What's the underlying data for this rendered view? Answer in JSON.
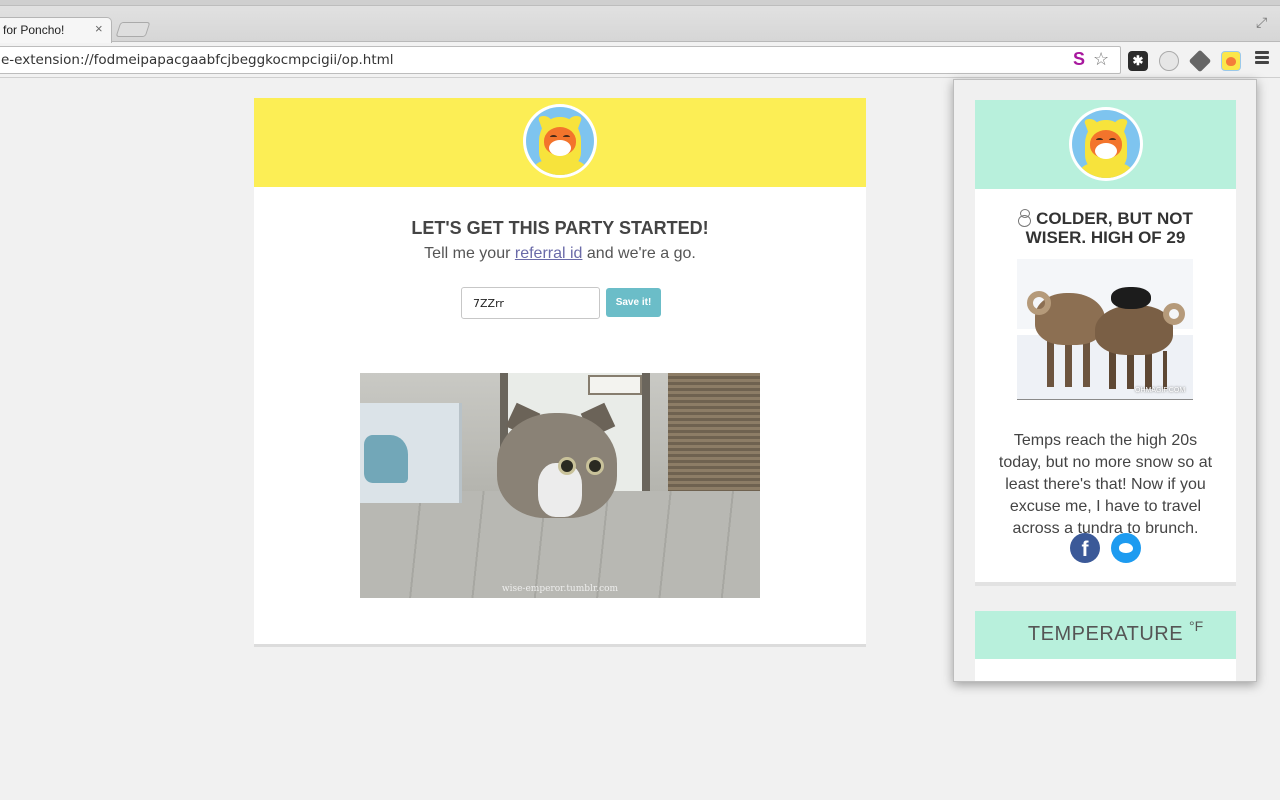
{
  "browser": {
    "tab_title": "for Poncho!",
    "tab_close": "×",
    "url": "e-extension://fodmeipapacgaabfcjbeggkocmpcigii/op.html",
    "omnibox_s": "S",
    "star": "☆",
    "fullscreen": "⤢",
    "extensions": [
      "puzzle-extension",
      "ghost-extension",
      "tag-extension",
      "poncho-extension"
    ]
  },
  "options_page": {
    "heading": "LET'S GET THIS PARTY STARTED!",
    "subtext_before": "Tell me your ",
    "subtext_link": "referral id",
    "subtext_after": " and we're a go.",
    "referral_value": "7ZZrr",
    "save_label": "Save it!",
    "gif_watermark": "wise-emperor.tumblr.com"
  },
  "popup": {
    "weather_title": "COLDER, BUT NOT WISER. HIGH OF 29",
    "gif_watermark": "OHMAGIF.COM",
    "weather_text": "Temps reach the high 20s today, but no more snow so at least there's that! Now if you excuse me, I have to travel across a tundra to brunch.",
    "facebook": "f",
    "temperature_title": "TEMPERATURE",
    "temperature_unit": "°F"
  },
  "colors": {
    "options_header": "#fcee55",
    "popup_header": "#b8f0dc",
    "save_button": "#6bbdc8",
    "facebook": "#3b5998",
    "twitter": "#1d9bf0"
  }
}
